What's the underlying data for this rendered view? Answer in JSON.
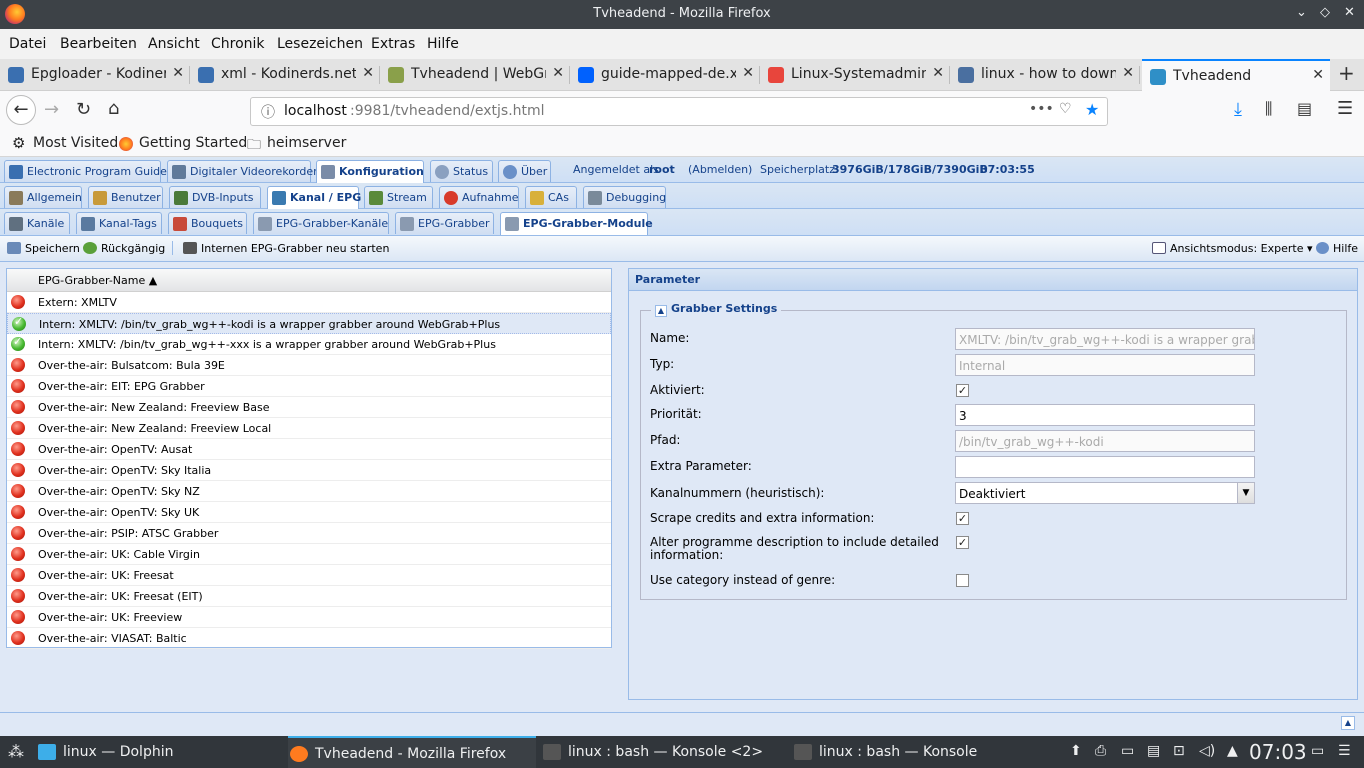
{
  "window": {
    "title": "Tvheadend - Mozilla Firefox"
  },
  "menu": [
    "Datei",
    "Bearbeiten",
    "Ansicht",
    "Chronik",
    "Lesezeichen",
    "Extras",
    "Hilfe"
  ],
  "browser_tabs": [
    {
      "label": "Epgloader - Kodinerds",
      "color": "#3a6fb0"
    },
    {
      "label": "xml - Kodinerds.net - ",
      "color": "#3a6fb0"
    },
    {
      "label": "Tvheadend | WebGrab",
      "color": "#8aa04a"
    },
    {
      "label": "guide-mapped-de.xml",
      "color": "#0061fe"
    },
    {
      "label": "Linux-Systemadministr",
      "color": "#e8453c"
    },
    {
      "label": "linux - how to downlo",
      "color": "#4a6fa0"
    },
    {
      "label": "Tvheadend",
      "color": "#2f8fc7"
    }
  ],
  "url": {
    "host": "localhost",
    "rest": ":9981/tvheadend/extjs.html"
  },
  "bookmarks": [
    "Most Visited",
    "Getting Started",
    "heimserver"
  ],
  "main_tabs": [
    {
      "label": "Electronic Program Guide",
      "color": "#3a6fb0"
    },
    {
      "label": "Digitaler Videorekorder",
      "color": "#607a9a"
    },
    {
      "label": "Konfiguration",
      "color": "#7a8ca8"
    },
    {
      "label": "Status",
      "color": "#8aa0c0"
    },
    {
      "label": "Über",
      "color": "#6a90c8"
    }
  ],
  "login": {
    "prefix": "Angemeldet als",
    "user": "root",
    "logout": "(Abmelden)",
    "storage_label": "Speicherplatz:",
    "storage": "3976GiB/178GiB/7390GiB",
    "time": "07:03:55"
  },
  "config_tabs": [
    {
      "label": "Allgemein",
      "color": "#8a7a5a"
    },
    {
      "label": "Benutzer",
      "color": "#c89a3a"
    },
    {
      "label": "DVB-Inputs",
      "color": "#4a7a3a"
    },
    {
      "label": "Kanal / EPG",
      "color": "#3a7ab0"
    },
    {
      "label": "Stream",
      "color": "#5a8a3a"
    },
    {
      "label": "Aufnahme",
      "color": "#d83a2a"
    },
    {
      "label": "CAs",
      "color": "#d8b03a"
    },
    {
      "label": "Debugging",
      "color": "#7a8a9a"
    }
  ],
  "epg_tabs": [
    {
      "label": "Kanäle",
      "color": "#607080"
    },
    {
      "label": "Kanal-Tags",
      "color": "#5a7aa0"
    },
    {
      "label": "Bouquets",
      "color": "#c84a3a"
    },
    {
      "label": "EPG-Grabber-Kanäle",
      "color": "#8a9ab0"
    },
    {
      "label": "EPG-Grabber",
      "color": "#8a9ab0"
    },
    {
      "label": "EPG-Grabber-Module",
      "color": "#8a9ab0"
    }
  ],
  "toolbar": {
    "save": "Speichern",
    "undo": "Rückgängig",
    "restart": "Internen EPG-Grabber neu starten",
    "view_mode": "Ansichtsmodus: Experte",
    "help": "Hilfe"
  },
  "grid": {
    "header": "EPG-Grabber-Name ▲",
    "rows": [
      {
        "name": "Extern: XMLTV",
        "status": "red"
      },
      {
        "name": "Intern: XMLTV: /bin/tv_grab_wg++-kodi is a wrapper grabber around WebGrab+Plus",
        "status": "green"
      },
      {
        "name": "Intern: XMLTV: /bin/tv_grab_wg++-xxx is a wrapper grabber around WebGrab+Plus",
        "status": "green"
      },
      {
        "name": "Over-the-air: Bulsatcom: Bula 39E",
        "status": "red"
      },
      {
        "name": "Over-the-air: EIT: EPG Grabber",
        "status": "red"
      },
      {
        "name": "Over-the-air: New Zealand: Freeview Base",
        "status": "red"
      },
      {
        "name": "Over-the-air: New Zealand: Freeview Local",
        "status": "red"
      },
      {
        "name": "Over-the-air: OpenTV: Ausat",
        "status": "red"
      },
      {
        "name": "Over-the-air: OpenTV: Sky Italia",
        "status": "red"
      },
      {
        "name": "Over-the-air: OpenTV: Sky NZ",
        "status": "red"
      },
      {
        "name": "Over-the-air: OpenTV: Sky UK",
        "status": "red"
      },
      {
        "name": "Over-the-air: PSIP: ATSC Grabber",
        "status": "red"
      },
      {
        "name": "Over-the-air: UK: Cable Virgin",
        "status": "red"
      },
      {
        "name": "Over-the-air: UK: Freesat",
        "status": "red"
      },
      {
        "name": "Over-the-air: UK: Freesat (EIT)",
        "status": "red"
      },
      {
        "name": "Over-the-air: UK: Freeview",
        "status": "red"
      },
      {
        "name": "Over-the-air: VIASAT: Baltic",
        "status": "red"
      }
    ]
  },
  "param": {
    "title": "Parameter",
    "group": "Grabber Settings",
    "name_label": "Name:",
    "name_value": "XMLTV: /bin/tv_grab_wg++-kodi is a wrapper grabber",
    "type_label": "Typ:",
    "type_value": "Internal",
    "enabled_label": "Aktiviert:",
    "enabled": "✓",
    "priority_label": "Priorität:",
    "priority_value": "3",
    "path_label": "Pfad:",
    "path_value": "/bin/tv_grab_wg++-kodi",
    "extra_label": "Extra Parameter:",
    "extra_value": "",
    "channum_label": "Kanalnummern (heuristisch):",
    "channum_value": "Deaktiviert",
    "scrape_label": "Scrape credits and extra information:",
    "scrape": "✓",
    "alter_label_1": "Alter programme description to include detailed",
    "alter_label_2": "information:",
    "alter": "✓",
    "category_label": "Use category instead of genre:",
    "category": ""
  },
  "taskbar": {
    "tasks": [
      {
        "label": "linux — Dolphin",
        "color": "#3daee9"
      },
      {
        "label": "Tvheadend - Mozilla Firefox",
        "color": "#ff7b1f"
      },
      {
        "label": "linux : bash — Konsole <2>",
        "color": "#555"
      },
      {
        "label": "linux : bash — Konsole",
        "color": "#555"
      }
    ],
    "clock": "07:03"
  }
}
